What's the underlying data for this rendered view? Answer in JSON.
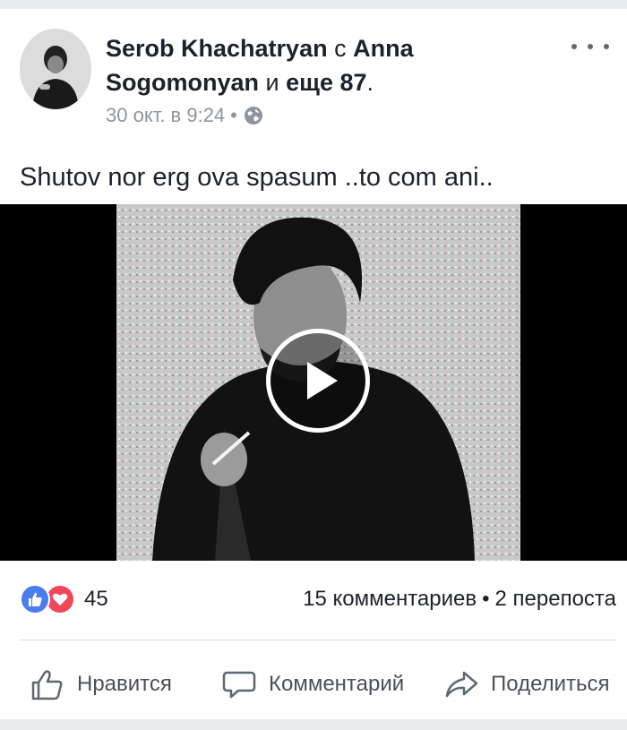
{
  "post": {
    "author": "Serob Khachatryan",
    "with_word": "с",
    "tagged": "Anna Sogomonyan",
    "and_word": "и",
    "others": "еще 87",
    "trailing": ".",
    "timestamp": "30 окт. в 9:24",
    "separator": "•",
    "privacy_icon": "globe-icon",
    "text": "Shutov nor erg ova spasum ..to com ani.."
  },
  "reactions": {
    "count": "45",
    "icons": [
      "like-icon",
      "love-icon"
    ]
  },
  "stats": {
    "comments": "15 комментариев",
    "separator": "•",
    "shares": "2 перепоста"
  },
  "actions": {
    "like": "Нравится",
    "comment": "Комментарий",
    "share": "Поделиться"
  },
  "colors": {
    "like_blue": "#4a7bf0",
    "love_red": "#f0465a",
    "meta_gray": "#90949c",
    "action_gray": "#4b4f56"
  }
}
